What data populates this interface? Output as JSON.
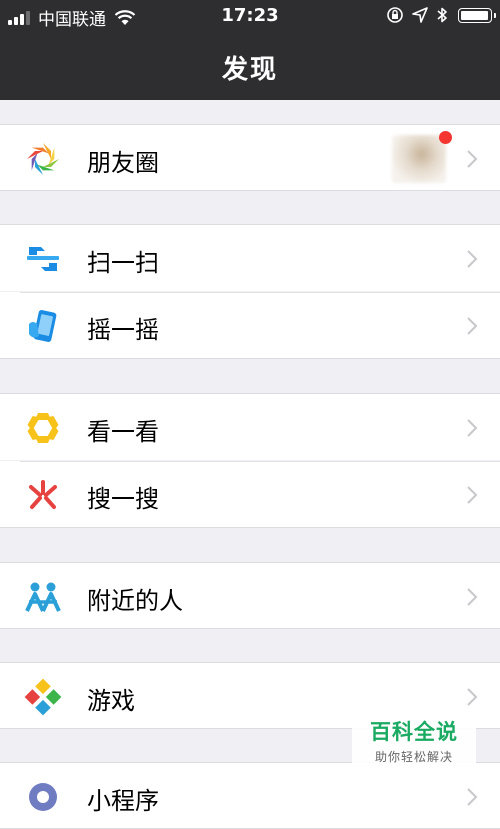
{
  "status_bar": {
    "carrier": "中国联通",
    "time": "17:23",
    "battery_level": 0.95
  },
  "nav": {
    "title": "发现"
  },
  "menu": [
    {
      "label": "朋友圈",
      "icon": "moments-icon"
    },
    {
      "label": "扫一扫",
      "icon": "scan-icon"
    },
    {
      "label": "摇一摇",
      "icon": "shake-icon"
    },
    {
      "label": "看一看",
      "icon": "top-stories-icon"
    },
    {
      "label": "搜一搜",
      "icon": "search-icon"
    },
    {
      "label": "附近的人",
      "icon": "people-nearby-icon"
    },
    {
      "label": "游戏",
      "icon": "games-icon"
    },
    {
      "label": "小程序",
      "icon": "mini-programs-icon"
    }
  ],
  "watermark": {
    "title": "百科全说",
    "subtitle": "助你轻松解决"
  },
  "colors": {
    "bar": "#2e2e31",
    "background": "#efeff4",
    "badge": "#f43530",
    "watermark": "#1aaa62"
  }
}
